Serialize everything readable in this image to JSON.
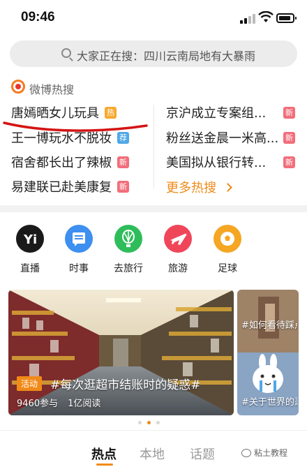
{
  "status_bar": {
    "time": "09:46"
  },
  "search": {
    "text": "大家正在搜：四川云南局地有大暴雨"
  },
  "hot_search": {
    "title": "微博热搜",
    "left": [
      {
        "text": "唐嫣晒女儿玩具",
        "badge": "热",
        "badge_type": "hot"
      },
      {
        "text": "王一博玩水不脱妆",
        "badge": "荐",
        "badge_type": "rec"
      },
      {
        "text": "宿舍都长出了辣椒",
        "badge": "新",
        "badge_type": "new"
      },
      {
        "text": "易建联已赴美康复",
        "badge": "新",
        "badge_type": "new"
      }
    ],
    "right": [
      {
        "text": "京沪成立专案组...",
        "badge": "新",
        "badge_type": "new"
      },
      {
        "text": "粉丝送金晨一米高...",
        "badge": "新",
        "badge_type": "new"
      },
      {
        "text": "美国拟从银行转...",
        "badge": "新",
        "badge_type": "new"
      }
    ],
    "more": "更多热搜"
  },
  "quick_links": [
    {
      "label": "直播",
      "icon": "live-icon",
      "color": "#1a1a1a"
    },
    {
      "label": "时事",
      "icon": "news-icon",
      "color": "#3d8ff0"
    },
    {
      "label": "去旅行",
      "icon": "balloon-icon",
      "color": "#2ebd5a"
    },
    {
      "label": "旅游",
      "icon": "plane-icon",
      "color": "#f0465a"
    },
    {
      "label": "足球",
      "icon": "football-icon",
      "color": "#f5a623"
    }
  ],
  "cards": {
    "main": {
      "tag": "活动",
      "title": "#每次逛超市结账时的疑惑#",
      "views": "9460参与",
      "reads": "1亿阅读"
    },
    "side": {
      "title_top": "#如何看待踩点上下...",
      "title_bottom": "#关于世界的恶意太..."
    }
  },
  "bottom_tabs": [
    "热点",
    "本地",
    "话题"
  ],
  "watermark": "粘土教程",
  "colors": {
    "accent": "#f08a18",
    "hot": "#f7a930",
    "new": "#f26e7a",
    "rec": "#4fa7e6"
  }
}
